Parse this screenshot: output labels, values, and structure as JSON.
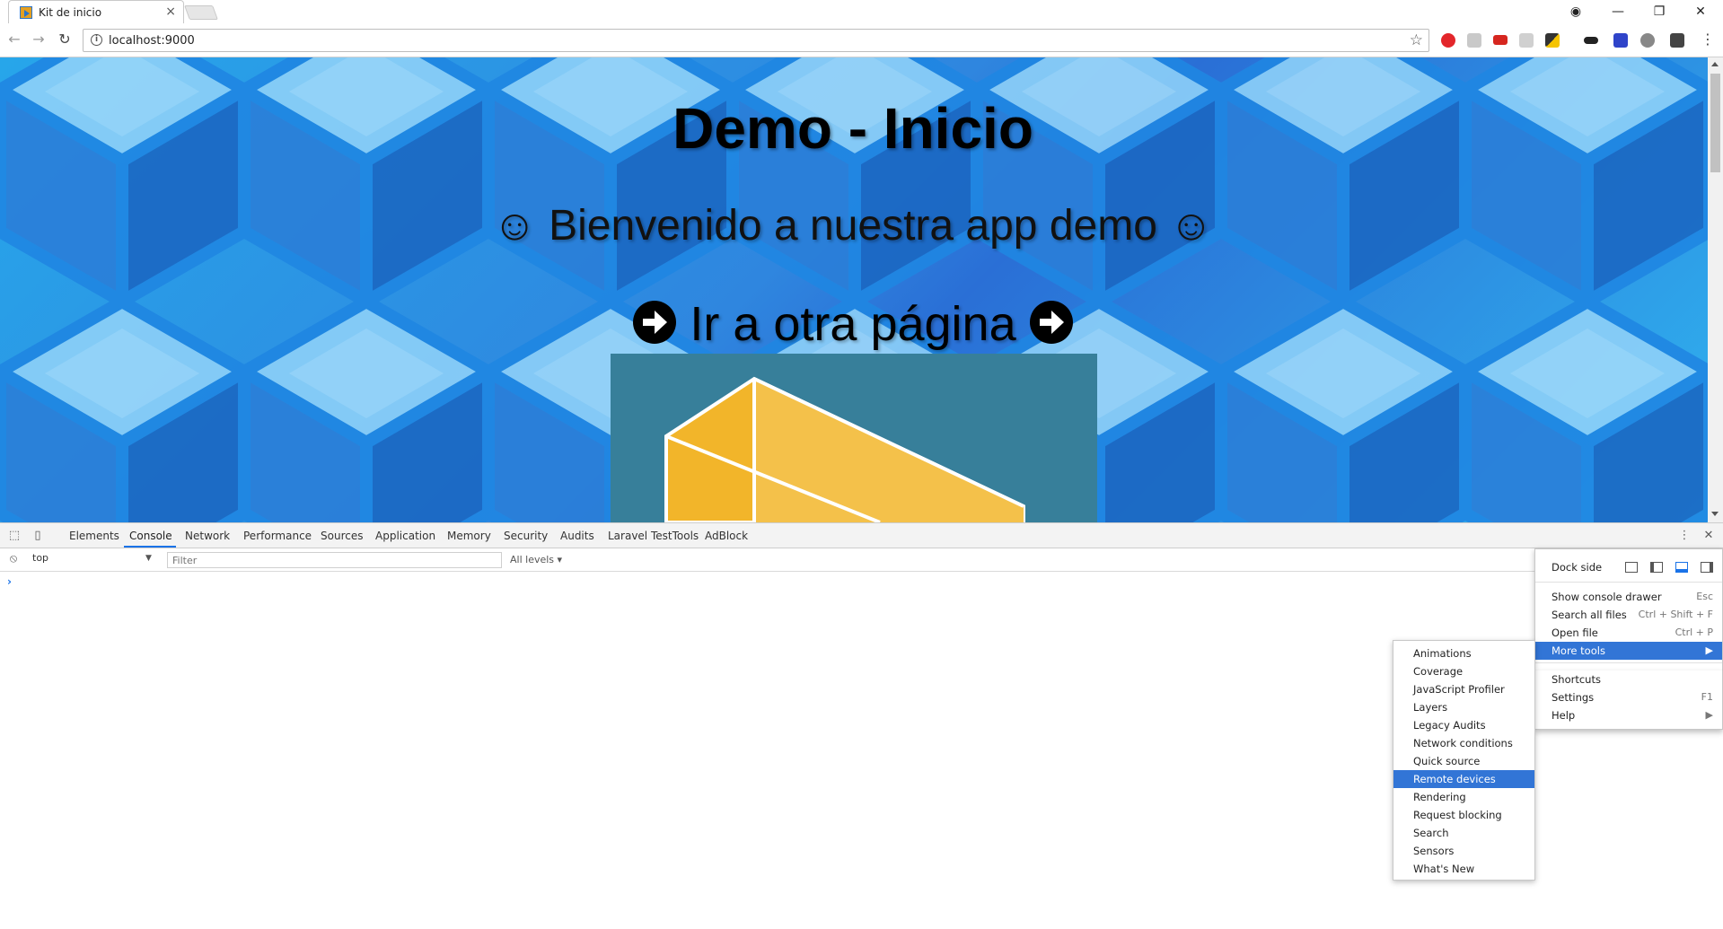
{
  "browser": {
    "tab": {
      "title": "Kit de inicio",
      "close": "×"
    },
    "window": {
      "profile": "◉",
      "minimize": "—",
      "restore": "❐",
      "close": "✕"
    },
    "toolbar": {
      "back": "←",
      "forward": "→",
      "reload": "↻",
      "info": "i",
      "url": "localhost:9000",
      "star": "☆",
      "menu": "⋮"
    }
  },
  "page": {
    "title": "Demo - Inicio",
    "subtitle": "☺ Bienvenido a nuestra app demo ☺",
    "link_text": "Ir a otra página"
  },
  "devtools": {
    "tabs": [
      "Elements",
      "Console",
      "Network",
      "Performance",
      "Sources",
      "Application",
      "Memory",
      "Security",
      "Audits",
      "Laravel TestTools",
      "AdBlock"
    ],
    "active_tab": "Console",
    "context": "top",
    "filter_placeholder": "Filter",
    "levels": "All levels ▾",
    "prompt": "›",
    "more": "⋮",
    "close": "✕"
  },
  "main_menu": {
    "dock_side_label": "Dock side",
    "items": [
      {
        "label": "Show console drawer",
        "shortcut": "Esc"
      },
      {
        "label": "Search all files",
        "shortcut": "Ctrl + Shift + F"
      },
      {
        "label": "Open file",
        "shortcut": "Ctrl + P"
      },
      {
        "label": "More tools",
        "shortcut": "▶"
      },
      {
        "label": "Shortcuts",
        "shortcut": ""
      },
      {
        "label": "Settings",
        "shortcut": "F1"
      },
      {
        "label": "Help",
        "shortcut": "▶"
      }
    ],
    "highlighted": "More tools"
  },
  "more_tools_menu": {
    "items": [
      "Animations",
      "Coverage",
      "JavaScript Profiler",
      "Layers",
      "Legacy Audits",
      "Network conditions",
      "Quick source",
      "Remote devices",
      "Rendering",
      "Request blocking",
      "Search",
      "Sensors",
      "What's New"
    ],
    "highlighted": "Remote devices"
  },
  "colors": {
    "accent": "#3275d6",
    "page_bg": "#2f86df",
    "hero_bg": "#377f9a",
    "cube_gold": "#f3b52a"
  }
}
